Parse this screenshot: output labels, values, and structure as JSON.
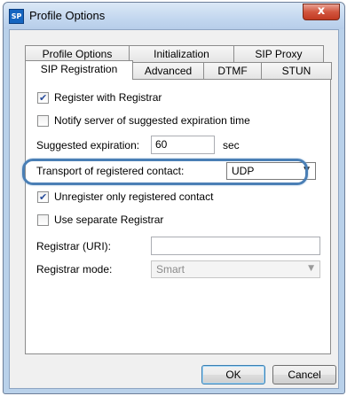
{
  "window": {
    "title": "Profile Options",
    "app_icon_text": "SP",
    "close_glyph": "x"
  },
  "tabs_row1": [
    {
      "label": "Profile Options"
    },
    {
      "label": "Initialization"
    },
    {
      "label": "SIP Proxy"
    }
  ],
  "tabs_row2": [
    {
      "label": "SIP Registration",
      "active": true
    },
    {
      "label": "Advanced"
    },
    {
      "label": "DTMF"
    },
    {
      "label": "STUN"
    }
  ],
  "form": {
    "register_with_registrar": {
      "label": "Register with Registrar",
      "checked": true
    },
    "notify_server": {
      "label": "Notify server of suggested expiration time",
      "checked": false
    },
    "suggested_expiration": {
      "label": "Suggested expiration:",
      "value": "60",
      "unit": "sec"
    },
    "transport": {
      "label": "Transport of registered contact:",
      "value": "UDP"
    },
    "unregister_only": {
      "label": "Unregister only registered contact",
      "checked": true
    },
    "use_separate_registrar": {
      "label": "Use separate Registrar",
      "checked": false
    },
    "registrar_uri": {
      "label": "Registrar (URI):",
      "value": ""
    },
    "registrar_mode": {
      "label": "Registrar mode:",
      "value": "Smart",
      "disabled": true
    }
  },
  "buttons": {
    "ok": "OK",
    "cancel": "Cancel"
  },
  "icons": {
    "app": "sip-app-icon",
    "close": "close-icon",
    "checkbox_checked": "checkmark-icon",
    "dropdown": "chevron-down-icon"
  },
  "colors": {
    "highlight_border": "#4a7fb5",
    "close_button": "#c13a22",
    "title_bar": "#c3d7ef",
    "check_color": "#2a4e9c"
  }
}
